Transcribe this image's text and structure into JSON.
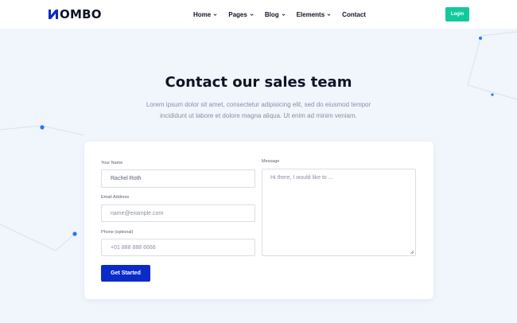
{
  "header": {
    "logo_text": "OMBO",
    "nav": [
      {
        "label": "Home",
        "has_dropdown": true
      },
      {
        "label": "Pages",
        "has_dropdown": true
      },
      {
        "label": "Blog",
        "has_dropdown": true
      },
      {
        "label": "Elements",
        "has_dropdown": true
      },
      {
        "label": "Contact",
        "has_dropdown": false
      }
    ],
    "login_label": "Login"
  },
  "hero": {
    "title": "Contact our sales team",
    "subtitle": "Lorem ipsum dolor sit amet, consectetur adipisicing elit, sed do eiusmod tempor incididunt ut labore et dolore magna aliqua. Ut enim ad minim veniam."
  },
  "form": {
    "name": {
      "label": "Your Name",
      "value": "Rachel Roth"
    },
    "email": {
      "label": "Email Address",
      "placeholder": "name@example.com"
    },
    "phone": {
      "label": "Phone (optional)",
      "value": "+01 888 888 6666"
    },
    "message": {
      "label": "Message",
      "placeholder": "Hi there, I would like to ..."
    },
    "submit_label": "Get Started"
  },
  "colors": {
    "accent_blue": "#0b2bc9",
    "login_green": "#12c99b",
    "dot_blue": "#1f7bf0",
    "page_bg": "#f1f5fc"
  }
}
